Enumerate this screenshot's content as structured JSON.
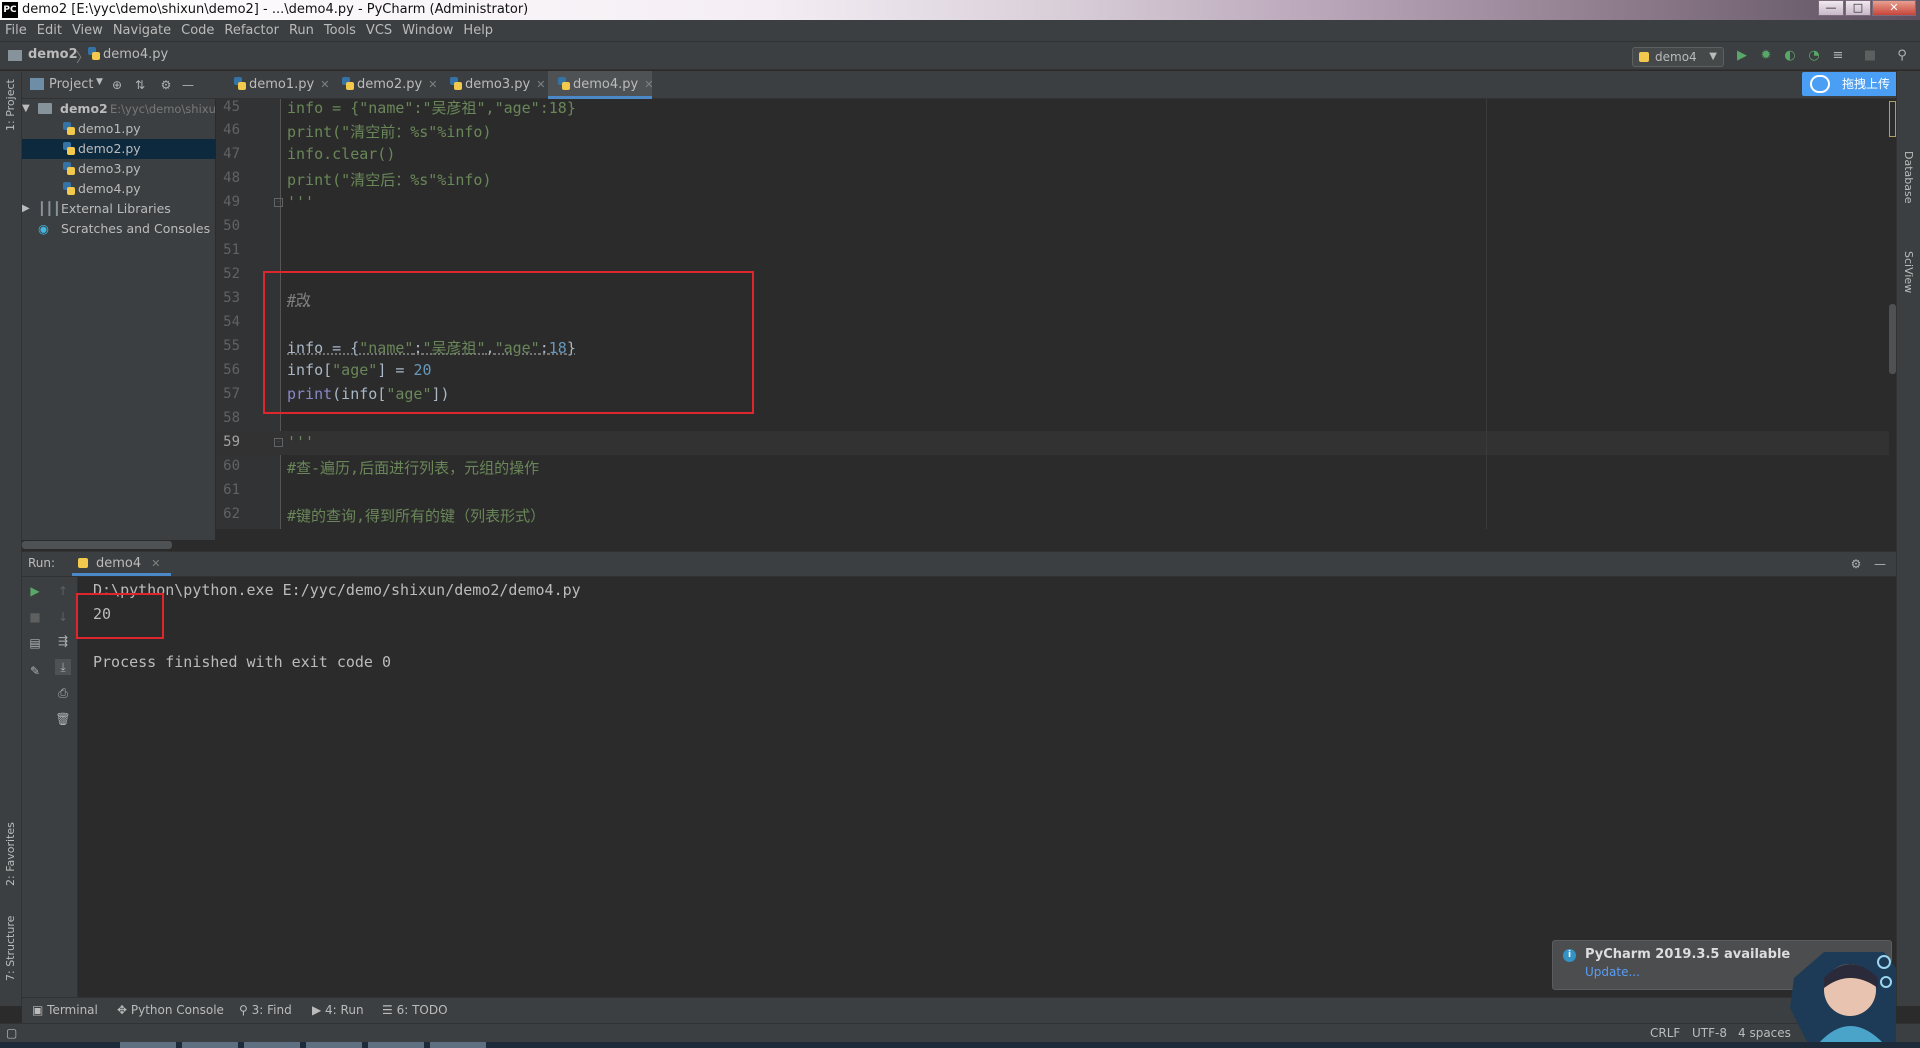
{
  "window": {
    "title": "demo2 [E:\\yyc\\demo\\shixun\\demo2] - ...\\demo4.py - PyCharm (Administrator)",
    "logo": "PC",
    "minimize": "—",
    "maximize": "□",
    "close": "✕"
  },
  "menu": [
    "File",
    "Edit",
    "View",
    "Navigate",
    "Code",
    "Refactor",
    "Run",
    "Tools",
    "VCS",
    "Window",
    "Help"
  ],
  "breadcrumb": {
    "project": "demo2",
    "file": "demo4.py"
  },
  "run_config": {
    "label": "demo4"
  },
  "upload_button": "拖拽上传",
  "left_stripe": {
    "project": "1: Project",
    "favorites": "2: Favorites",
    "structure": "7: Structure"
  },
  "right_stripe": {
    "database": "Database",
    "sciview": "SciView"
  },
  "project_panel": {
    "header": "Project",
    "root": {
      "name": "demo2",
      "path": "E:\\yyc\\demo\\shixu"
    },
    "files": [
      "demo1.py",
      "demo2.py",
      "demo3.py",
      "demo4.py"
    ],
    "selected": "demo2.py",
    "external_libraries": "External Libraries",
    "scratches": "Scratches and Consoles"
  },
  "editor_tabs": [
    {
      "label": "demo1.py",
      "active": false
    },
    {
      "label": "demo2.py",
      "active": false
    },
    {
      "label": "demo3.py",
      "active": false
    },
    {
      "label": "demo4.py",
      "active": true
    }
  ],
  "code_lines": {
    "n45": "45",
    "n46": "46",
    "n47": "47",
    "n48": "48",
    "n49": "49",
    "n50": "50",
    "n51": "51",
    "n52": "52",
    "n53": "53",
    "n54": "54",
    "n55": "55",
    "n56": "56",
    "n57": "57",
    "n58": "58",
    "n59": "59",
    "n60": "60",
    "n61": "61",
    "n62": "62",
    "l45a": "info = {",
    "l45b": "\"name\"",
    "l45c": ":",
    "l45d": "\"吴彦祖\"",
    "l45e": ",",
    "l45f": "\"age\"",
    "l45g": ":",
    "l45h": "18",
    "l45i": "}",
    "l46": "print(\"清空前：%s\"%info)",
    "l47": "info.clear()",
    "l48": "print(\"清空后：%s\"%info)",
    "l49": "'''",
    "l53": "#改",
    "l55a": "info = {",
    "l55b": "\"name\"",
    "l55c": ":",
    "l55d": "\"吴彦祖\"",
    "l55e": ",",
    "l55f": "\"age\"",
    "l55g": ":",
    "l55h": "18",
    "l55i": "}",
    "l56a": "info[",
    "l56b": "\"age\"",
    "l56c": "] = ",
    "l56d": "20",
    "l57a": "print",
    "l57b": "(info[",
    "l57c": "\"age\"",
    "l57d": "])",
    "l59": "'''",
    "l60": "#查-遍历,后面进行列表，元组的操作",
    "l62": "#键的查询,得到所有的键（列表形式）"
  },
  "run_panel": {
    "label": "Run:",
    "tab": "demo4",
    "command": "D:\\python\\python.exe E:/yyc/demo/shixun/demo2/demo4.py",
    "output": "20",
    "exit_message": "Process finished with exit code 0"
  },
  "bottom_tabs": [
    "Terminal",
    "Python Console",
    "3: Find",
    "4: Run",
    "6: TODO"
  ],
  "notification": {
    "title": "PyCharm 2019.3.5 available",
    "link": "Update..."
  },
  "status": {
    "line_sep": "CRLF",
    "encoding": "UTF-8",
    "indent": "4 spaces"
  },
  "colors": {
    "accent": "#4a88c7",
    "highlight_box": "#e0262d",
    "string": "#6a8759",
    "number": "#6897bb",
    "builtin": "#8888c6",
    "comment": "#629755"
  }
}
